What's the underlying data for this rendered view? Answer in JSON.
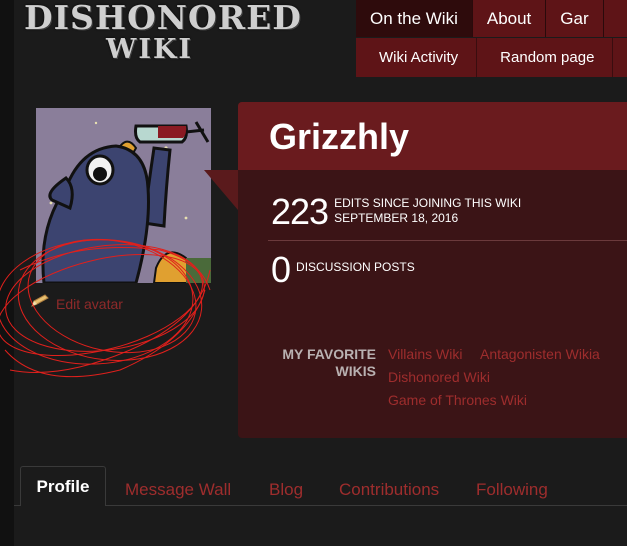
{
  "logo": {
    "line1": "DISHONORED",
    "line2": "WIKI"
  },
  "nav": {
    "top": [
      "On the Wiki",
      "About",
      "Gar"
    ],
    "sub": [
      "Wiki Activity",
      "Random page"
    ]
  },
  "profile": {
    "username": "Grizzhly",
    "edit_avatar": "Edit avatar",
    "edits": {
      "count": "223",
      "desc_line1": "EDITS SINCE JOINING THIS WIKI",
      "desc_line2": "SEPTEMBER 18, 2016"
    },
    "posts": {
      "count": "0",
      "desc": "DISCUSSION POSTS"
    },
    "favorites_label_line1": "MY FAVORITE",
    "favorites_label_line2": "WIKIS",
    "favorites": [
      "Villains Wiki",
      "Antagonisten Wikia",
      "Dishonored Wiki",
      "Game of Thrones Wiki"
    ]
  },
  "tabs": [
    "Profile",
    "Message Wall",
    "Blog",
    "Contributions",
    "Following"
  ],
  "colors": {
    "accent": "#5e1417",
    "card": "#3b1416",
    "link": "#9e2d2d"
  }
}
